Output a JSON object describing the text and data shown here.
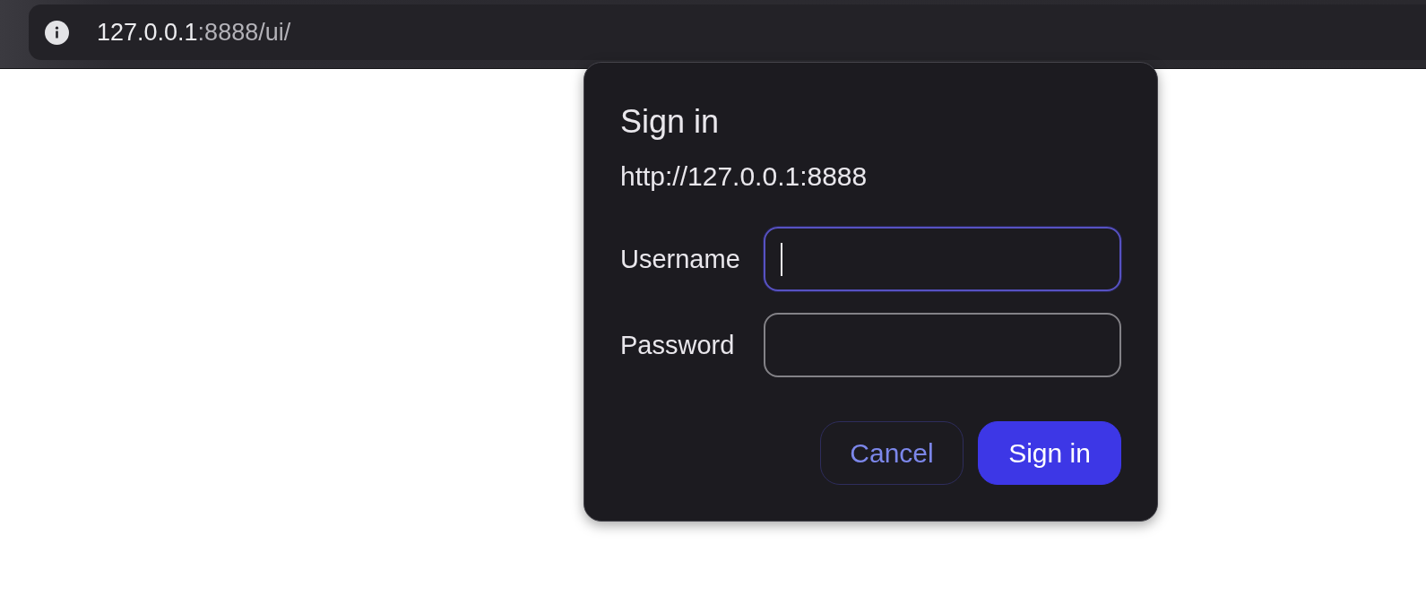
{
  "browser": {
    "address": {
      "host": "127.0.0.1",
      "rest": ":8888/ui/"
    }
  },
  "dialog": {
    "title": "Sign in",
    "origin": "http://127.0.0.1:8888",
    "fields": [
      {
        "label": "Username",
        "focused": true
      },
      {
        "label": "Password",
        "focused": false
      }
    ],
    "buttons": [
      {
        "label": "Cancel",
        "kind": "secondary"
      },
      {
        "label": "Sign in",
        "kind": "primary"
      }
    ]
  }
}
